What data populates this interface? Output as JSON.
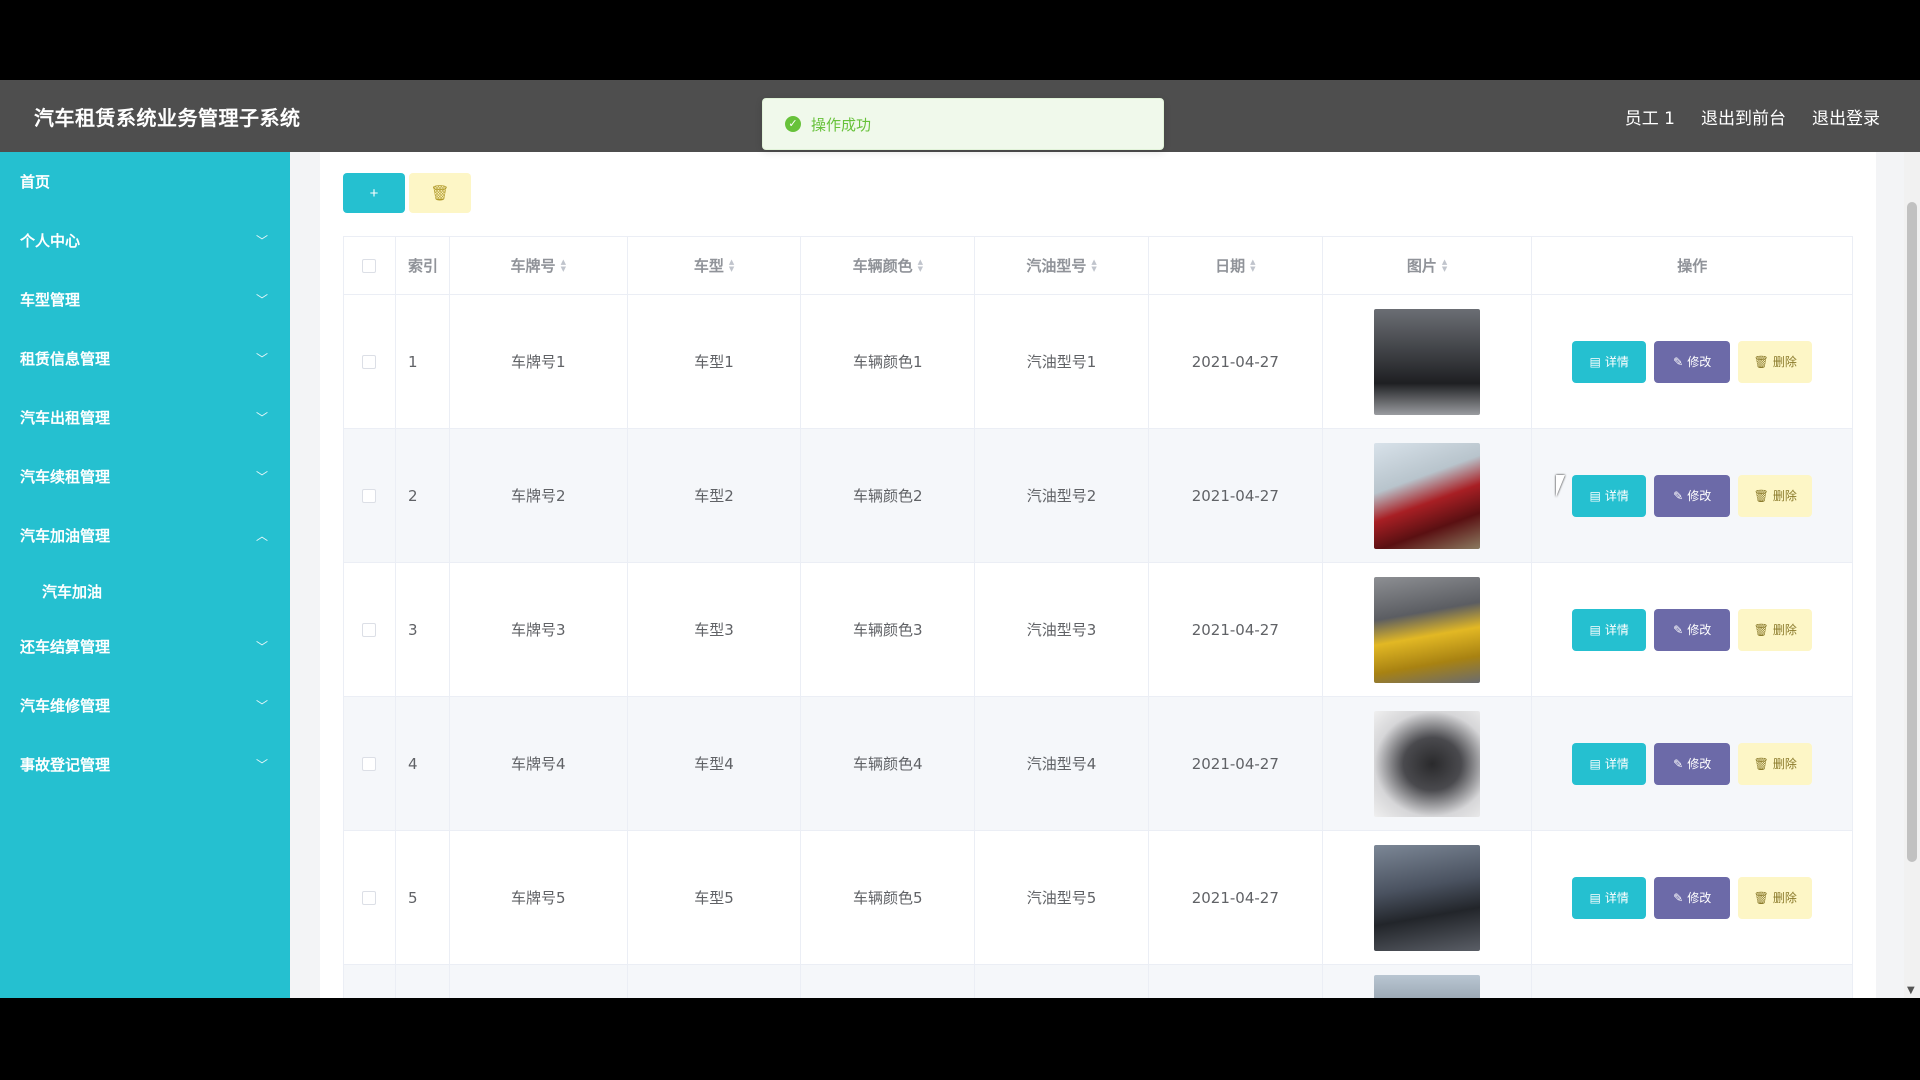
{
  "header": {
    "title": "汽车租赁系统业务管理子系统",
    "user": "员工 1",
    "back_to_front": "退出到前台",
    "logout": "退出登录"
  },
  "toast": {
    "message": "操作成功"
  },
  "sidebar": {
    "items": [
      {
        "label": "首页"
      },
      {
        "label": "个人中心"
      },
      {
        "label": "车型管理"
      },
      {
        "label": "租赁信息管理"
      },
      {
        "label": "汽车出租管理"
      },
      {
        "label": "汽车续租管理"
      },
      {
        "label": "汽车加油管理"
      },
      {
        "label": "汽车加油"
      },
      {
        "label": "还车结算管理"
      },
      {
        "label": "汽车维修管理"
      },
      {
        "label": "事故登记管理"
      }
    ]
  },
  "toolbar": {
    "add_label": "+",
    "batch_delete_icon": "trash-icon"
  },
  "table": {
    "columns": [
      "索引",
      "车牌号",
      "车型",
      "车辆颜色",
      "汽油型号",
      "日期",
      "图片",
      "操作"
    ],
    "rows": [
      {
        "index": "1",
        "plate": "车牌号1",
        "model": "车型1",
        "color": "车辆颜色1",
        "fuel": "汽油型号1",
        "date": "2021-04-27"
      },
      {
        "index": "2",
        "plate": "车牌号2",
        "model": "车型2",
        "color": "车辆颜色2",
        "fuel": "汽油型号2",
        "date": "2021-04-27"
      },
      {
        "index": "3",
        "plate": "车牌号3",
        "model": "车型3",
        "color": "车辆颜色3",
        "fuel": "汽油型号3",
        "date": "2021-04-27"
      },
      {
        "index": "4",
        "plate": "车牌号4",
        "model": "车型4",
        "color": "车辆颜色4",
        "fuel": "汽油型号4",
        "date": "2021-04-27"
      },
      {
        "index": "5",
        "plate": "车牌号5",
        "model": "车型5",
        "color": "车辆颜色5",
        "fuel": "汽油型号5",
        "date": "2021-04-27"
      }
    ],
    "actions": {
      "detail": "详情",
      "edit": "修改",
      "delete": "删除"
    }
  },
  "colors": {
    "accent": "#25c0d0",
    "header": "#4e4e4e",
    "edit": "#6c6aa8",
    "delete_bg": "#fdf6c6",
    "success": "#67c23a"
  }
}
